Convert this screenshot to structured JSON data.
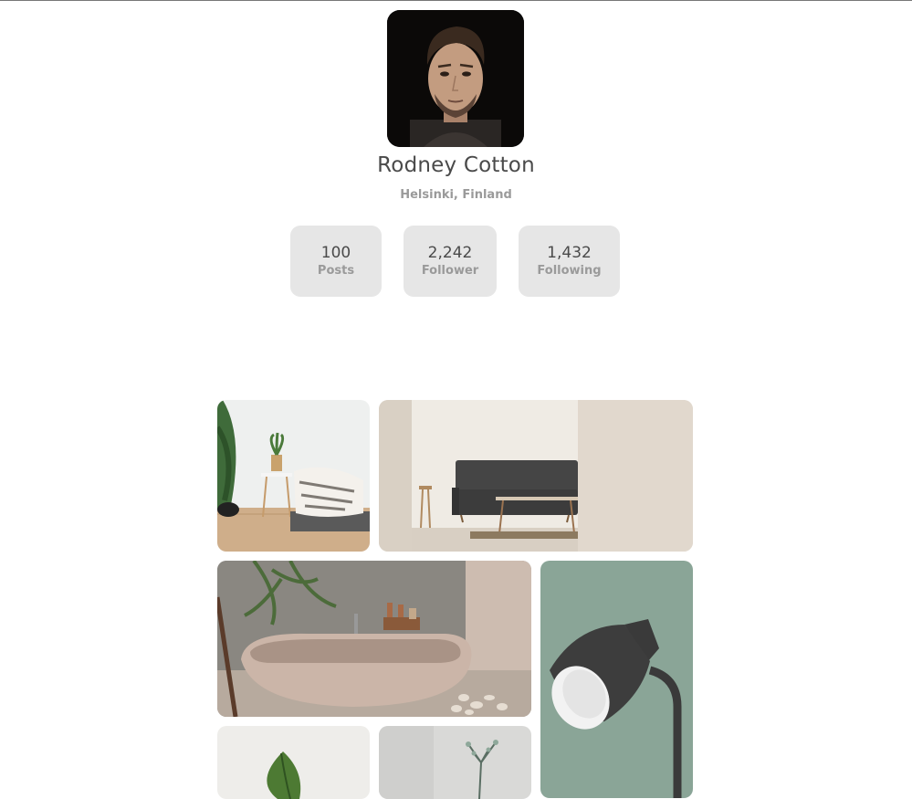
{
  "profile": {
    "name": "Rodney Cotton",
    "location": "Helsinki, Finland"
  },
  "stats": {
    "posts": {
      "value": "100",
      "label": "Posts"
    },
    "follower": {
      "value": "2,242",
      "label": "Follower"
    },
    "following": {
      "value": "1,432",
      "label": "Following"
    }
  },
  "gallery": [
    {
      "name": "living-room-plant-photo"
    },
    {
      "name": "grey-sofa-photo"
    },
    {
      "name": "bathtub-photo"
    },
    {
      "name": "desk-lamp-photo"
    },
    {
      "name": "leaf-plant-photo"
    },
    {
      "name": "branch-vase-photo"
    }
  ]
}
